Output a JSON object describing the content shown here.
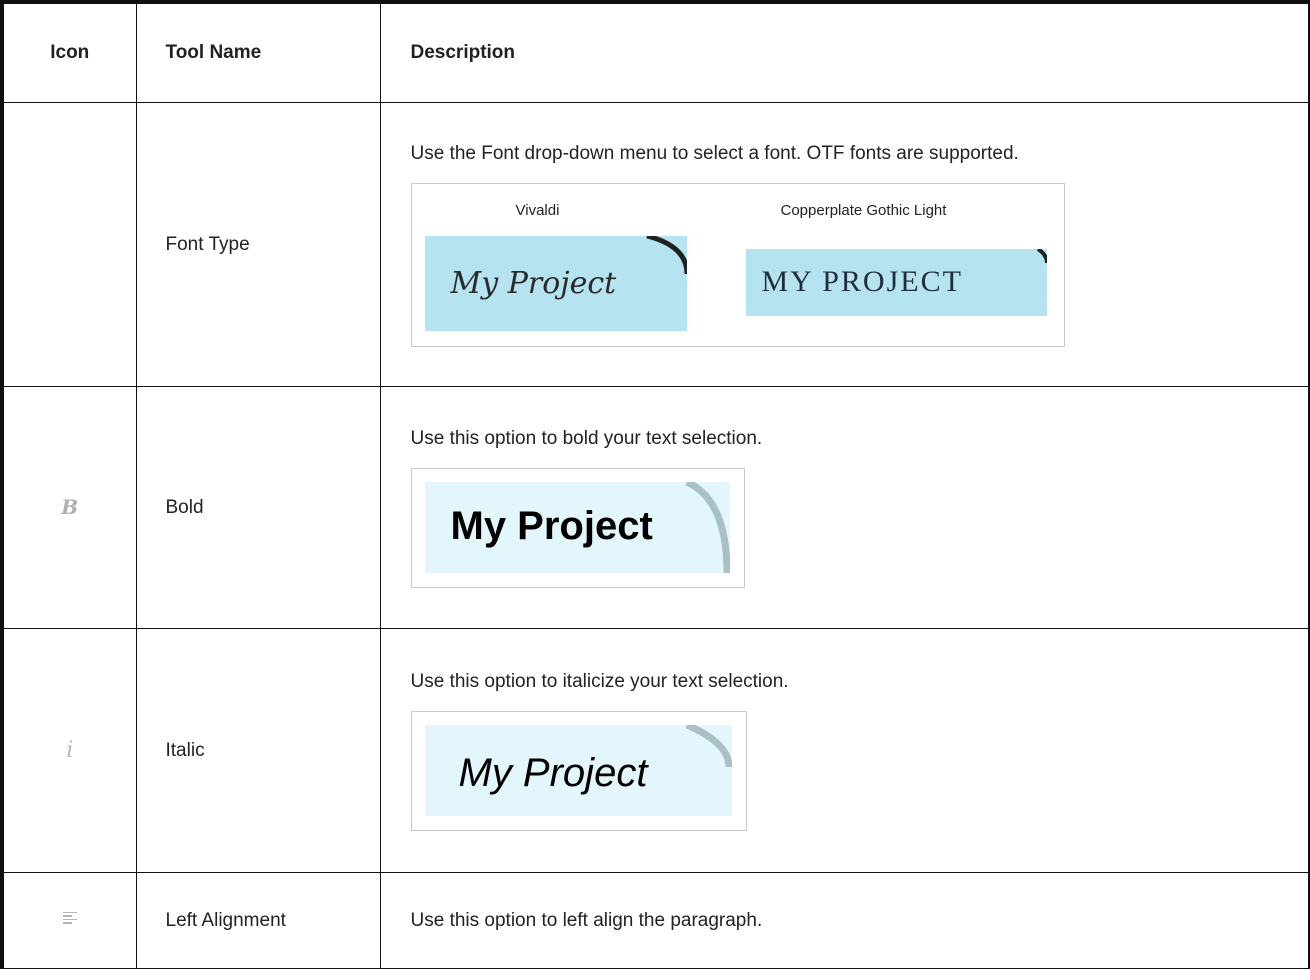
{
  "table": {
    "headers": {
      "icon": "Icon",
      "name": "Tool Name",
      "description": "Description"
    },
    "rows": [
      {
        "icon": "font-type-icon",
        "name": "Font Type",
        "description": "Use the Font drop-down menu to select a font. OTF fonts are supported.",
        "sample": {
          "left_caption": "Vivaldi",
          "left_text": "My Project",
          "right_caption": "Copperplate Gothic Light",
          "right_text": "MY PROJECT"
        }
      },
      {
        "icon": "bold-icon",
        "icon_glyph": "B",
        "name": "Bold",
        "description": "Use this option to bold your text selection.",
        "sample": {
          "text": "My Project"
        }
      },
      {
        "icon": "italic-icon",
        "icon_glyph": "i",
        "name": "Italic",
        "description": "Use this option to italicize your text selection.",
        "sample": {
          "text": "My Project"
        }
      },
      {
        "icon": "left-align-icon",
        "name": "Left Alignment",
        "description": "Use this option to left align the paragraph."
      }
    ]
  },
  "colors": {
    "swatch": "#b5e3ef",
    "swatch_light": "#e3f6fb",
    "border": "#111111"
  }
}
